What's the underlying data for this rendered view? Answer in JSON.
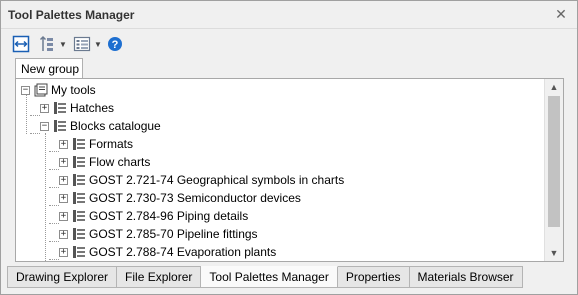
{
  "window": {
    "title": "Tool Palettes Manager"
  },
  "toolbar": {
    "buttons": [
      {
        "icon": "fit-width-icon"
      },
      {
        "icon": "sort-icon",
        "dropdown": true
      },
      {
        "icon": "view-list-icon",
        "dropdown": true
      },
      {
        "icon": "help-icon"
      }
    ]
  },
  "group_tab": {
    "label": "New group"
  },
  "tree": {
    "root": {
      "label": "My tools",
      "expanded": true
    },
    "items": [
      {
        "label": "Hatches",
        "expanded": false,
        "level": 1
      },
      {
        "label": "Blocks catalogue",
        "expanded": true,
        "level": 1
      },
      {
        "label": "Formats",
        "expanded": false,
        "level": 2
      },
      {
        "label": "Flow charts",
        "expanded": false,
        "level": 2
      },
      {
        "label": "GOST 2.721-74 Geographical symbols in charts",
        "expanded": false,
        "level": 2
      },
      {
        "label": "GOST 2.730-73 Semiconductor devices",
        "expanded": false,
        "level": 2
      },
      {
        "label": "GOST 2.784-96 Piping details",
        "expanded": false,
        "level": 2
      },
      {
        "label": "GOST 2.785-70 Pipeline fittings",
        "expanded": false,
        "level": 2
      },
      {
        "label": "GOST 2.788-74 Evaporation plants",
        "expanded": false,
        "level": 2
      }
    ]
  },
  "bottom_tabs": [
    {
      "label": "Drawing Explorer",
      "active": false
    },
    {
      "label": "File Explorer",
      "active": false
    },
    {
      "label": "Tool Palettes Manager",
      "active": true
    },
    {
      "label": "Properties",
      "active": false
    },
    {
      "label": "Materials Browser",
      "active": false
    }
  ],
  "colors": {
    "help": "#1e6fd0",
    "accent": "#1a5fb4"
  }
}
